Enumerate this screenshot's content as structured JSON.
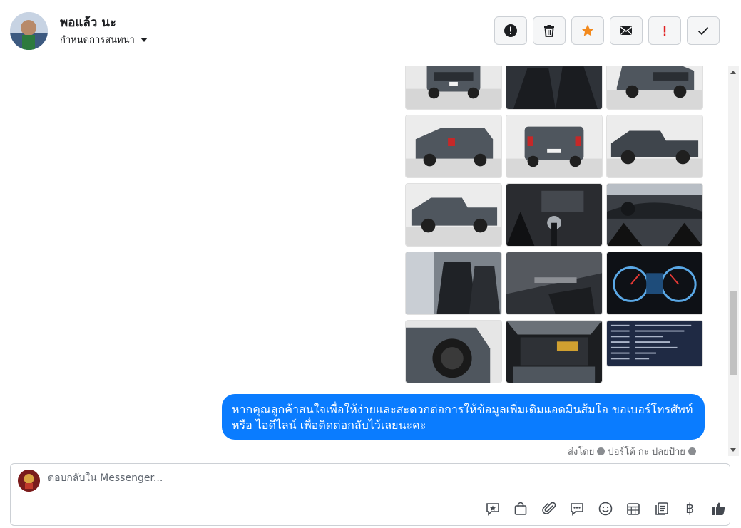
{
  "header": {
    "contact_name": "พอแล้ว นะ",
    "conversation_label": "กำหนดการสนทนา",
    "actions": [
      {
        "name": "spam",
        "icon": "alert-circle-icon",
        "color": "#1c1e21"
      },
      {
        "name": "delete",
        "icon": "trash-icon",
        "color": "#1c1e21"
      },
      {
        "name": "star",
        "icon": "star-icon",
        "color": "#f28a1e"
      },
      {
        "name": "unread",
        "icon": "envelope-icon",
        "color": "#1c1e21"
      },
      {
        "name": "important",
        "icon": "exclamation-icon",
        "color": "#e02020"
      },
      {
        "name": "done",
        "icon": "checkmark-icon",
        "color": "#1c1e21"
      }
    ]
  },
  "chat": {
    "images": [
      {
        "subject": "truck-front"
      },
      {
        "subject": "interior-seats"
      },
      {
        "subject": "truck-front-angle"
      },
      {
        "subject": "truck-rear-angle"
      },
      {
        "subject": "truck-rear"
      },
      {
        "subject": "truck-side"
      },
      {
        "subject": "truck-side-profile"
      },
      {
        "subject": "gear-shifter"
      },
      {
        "subject": "dashboard"
      },
      {
        "subject": "front-seats"
      },
      {
        "subject": "door-panel"
      },
      {
        "subject": "gauge-cluster"
      },
      {
        "subject": "wheel-closeup"
      },
      {
        "subject": "engine-bay"
      },
      {
        "subject": "spec-sheet"
      }
    ],
    "message_text": "หากคุณลูกค้าสนใจเพื่อให้ง่ายและสะดวกต่อการให้ข้อมูลเพิ่มเติมแอดมินส้มโอ ขอเบอร์โทรศัพท์ หรือ ไอดีไลน์ เพื่อติดต่อกลับไว้เลยนะคะ",
    "sent_by_prefix": "ส่งโดย",
    "sent_by_name": "ปอร์โต้ กะ ปลยป้าย",
    "bubble_color": "#0a7cff"
  },
  "composer": {
    "placeholder": "ตอบกลับใน Messenger...",
    "tools": [
      "quick-reply-icon",
      "shop-bag-icon",
      "attachment-icon",
      "saved-replies-icon",
      "emoji-icon",
      "appointment-icon",
      "template-icon",
      "baht-icon",
      "thumbs-up-icon"
    ],
    "baht_symbol": "฿"
  }
}
